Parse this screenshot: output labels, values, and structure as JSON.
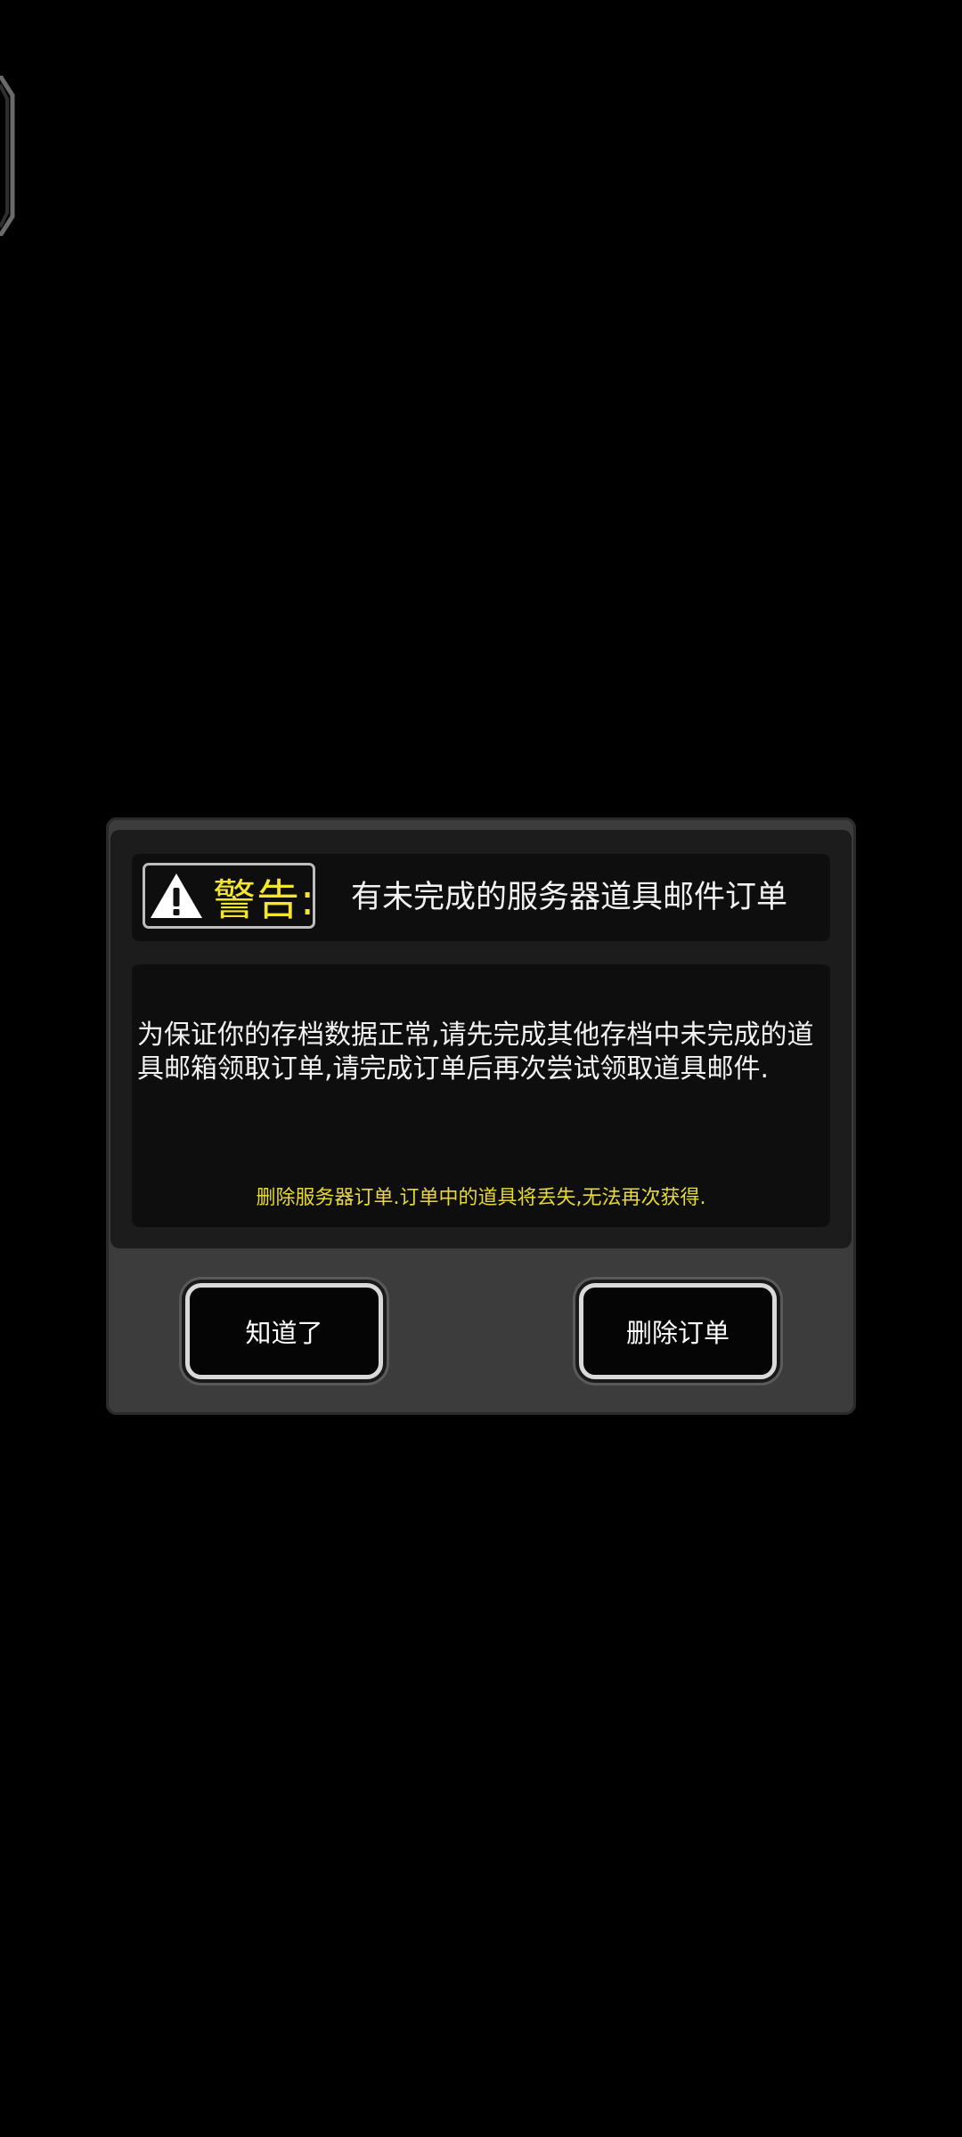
{
  "dialog": {
    "warning_label": "警告:",
    "title": "有未完成的服务器道具邮件订单",
    "message": "为保证你的存档数据正常,请先完成其他存档中未完成的道具邮箱领取订单,请完成订单后再次尝试领取道具邮件.",
    "note": "删除服务器订单.订单中的道具将丢失,无法再次获得.",
    "buttons": {
      "ok_label": "知道了",
      "delete_label": "删除订单"
    }
  },
  "icons": {
    "warning": "warning-triangle-icon"
  },
  "colors": {
    "background": "#000000",
    "dialog_frame": "#3c3c3c",
    "panel": "#0e0e0e",
    "warning_yellow": "#f5e62b",
    "note_yellow": "#e8da32",
    "text": "#f2f2f2"
  }
}
